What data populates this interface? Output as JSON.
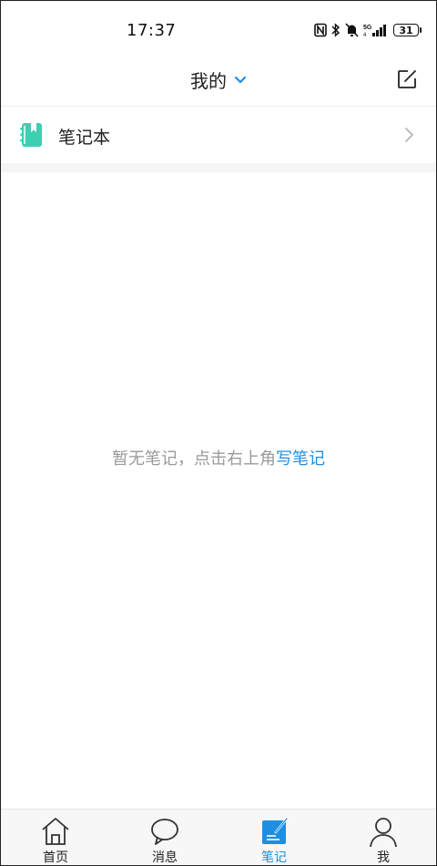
{
  "status_bar": {
    "time": "17:37",
    "network": "5G",
    "battery": "31"
  },
  "header": {
    "title": "我的",
    "dropdown_icon": "chevron-down-icon",
    "edit_icon": "edit-icon"
  },
  "notebook": {
    "label": "笔记本",
    "icon": "notebook-icon"
  },
  "empty_state": {
    "text": "暂无笔记，点击右上角",
    "link": "写笔记"
  },
  "bottom_nav": {
    "items": [
      {
        "label": "首页",
        "icon": "home-icon"
      },
      {
        "label": "消息",
        "icon": "message-icon"
      },
      {
        "label": "笔记",
        "icon": "note-icon",
        "active": true
      },
      {
        "label": "我",
        "icon": "profile-icon"
      }
    ]
  },
  "colors": {
    "accent": "#1e8fe0",
    "notebook_icon": "#3ecfb3",
    "muted_text": "#9a9a9a"
  }
}
